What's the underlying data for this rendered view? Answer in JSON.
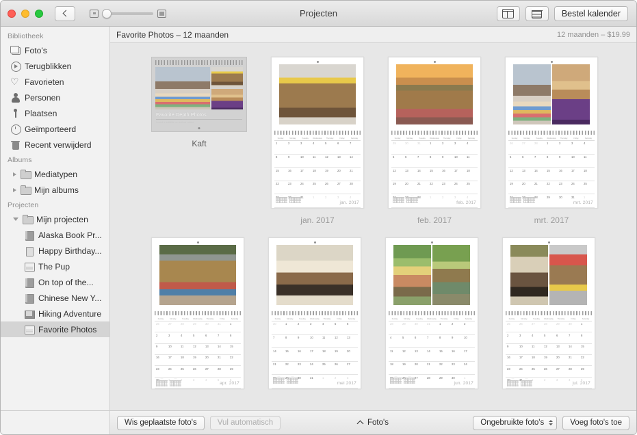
{
  "window": {
    "title": "Projecten",
    "back_button": "back-chevron",
    "order_button": "Bestel kalender",
    "layout_icon": "layout-icon",
    "info_icon": "note-icon",
    "zoom_small_icon": "zoom-out-icon",
    "zoom_large_icon": "zoom-in-icon"
  },
  "sidebar": {
    "sections": [
      {
        "header": "Bibliotheek",
        "items": [
          {
            "label": "Foto's",
            "icon": "photos-icon"
          },
          {
            "label": "Terugblikken",
            "icon": "memories-icon"
          },
          {
            "label": "Favorieten",
            "icon": "heart-icon"
          },
          {
            "label": "Personen",
            "icon": "person-icon"
          },
          {
            "label": "Plaatsen",
            "icon": "pin-icon"
          },
          {
            "label": "Geïmporteerd",
            "icon": "clock-icon"
          },
          {
            "label": "Recent verwijderd",
            "icon": "trash-icon"
          }
        ]
      },
      {
        "header": "Albums",
        "items": [
          {
            "label": "Mediatypen",
            "icon": "folder-icon",
            "disclosure": "collapsed"
          },
          {
            "label": "Mijn albums",
            "icon": "folder-icon",
            "disclosure": "collapsed"
          }
        ]
      },
      {
        "header": "Projecten",
        "items": [
          {
            "label": "Mijn projecten",
            "icon": "folder-icon",
            "disclosure": "expanded"
          }
        ],
        "children": [
          {
            "label": "Alaska Book Pr...",
            "icon": "book-icon",
            "selected": false
          },
          {
            "label": "Happy Birthday...",
            "icon": "card-icon",
            "selected": false
          },
          {
            "label": "The Pup",
            "icon": "calendar-icon",
            "selected": false
          },
          {
            "label": "On top of the...",
            "icon": "book-icon",
            "selected": false
          },
          {
            "label": "Chinese New Y...",
            "icon": "book-icon",
            "selected": false
          },
          {
            "label": "Hiking Adventure",
            "icon": "slideshow-icon",
            "selected": false
          },
          {
            "label": "Favorite Photos",
            "icon": "calendar-icon",
            "selected": true
          }
        ]
      }
    ]
  },
  "content_header": {
    "title": "Favorite Photos – 12 maanden",
    "price": "12 maanden – $19.99"
  },
  "cover": {
    "title": "Favorite Depth Photos",
    "subtitle": "Insert a subtitle or author name",
    "caption": "Kaft",
    "selected": true
  },
  "pages": [
    {
      "caption": "jan. 2017",
      "month_label": "jan. 2017",
      "photos": 1,
      "minicals": 2
    },
    {
      "caption": "feb. 2017",
      "month_label": "feb. 2017",
      "photos": 1,
      "minicals": 2
    },
    {
      "caption": "mrt. 2017",
      "month_label": "mrt. 2017",
      "photos": 2,
      "minicals": 2
    },
    {
      "caption": "",
      "month_label": "apr. 2017",
      "photos": 1,
      "minicals": 2
    },
    {
      "caption": "",
      "month_label": "mei 2017",
      "photos": 1,
      "minicals": 2
    },
    {
      "caption": "",
      "month_label": "jun. 2017",
      "photos": 2,
      "minicals": 2
    },
    {
      "caption": "",
      "month_label": "jul. 2017",
      "photos": 2,
      "minicals": 2
    }
  ],
  "calendar": {
    "day_names": [
      "Sunday",
      "Monday",
      "Tuesday",
      "Wednesday",
      "Thursday",
      "Friday",
      "Saturday"
    ],
    "grids": {
      "jan. 2017": [
        [
          "1",
          "2",
          "3",
          "4",
          "5",
          "6",
          "7"
        ],
        [
          "8",
          "9",
          "10",
          "11",
          "12",
          "13",
          "14"
        ],
        [
          "15",
          "16",
          "17",
          "18",
          "19",
          "20",
          "21"
        ],
        [
          "22",
          "23",
          "24",
          "25",
          "26",
          "27",
          "28"
        ],
        [
          "29",
          "30",
          "31",
          "1",
          "2",
          "3",
          "4"
        ]
      ],
      "feb. 2017": [
        [
          "29",
          "30",
          "31",
          "1",
          "2",
          "3",
          "4"
        ],
        [
          "5",
          "6",
          "7",
          "8",
          "9",
          "10",
          "11"
        ],
        [
          "12",
          "13",
          "14",
          "15",
          "16",
          "17",
          "18"
        ],
        [
          "19",
          "20",
          "21",
          "22",
          "23",
          "24",
          "25"
        ],
        [
          "26",
          "27",
          "28",
          "1",
          "2",
          "3",
          "4"
        ]
      ],
      "mrt. 2017": [
        [
          "26",
          "27",
          "28",
          "1",
          "2",
          "3",
          "4"
        ],
        [
          "5",
          "6",
          "7",
          "8",
          "9",
          "10",
          "11"
        ],
        [
          "12",
          "13",
          "14",
          "15",
          "16",
          "17",
          "18"
        ],
        [
          "19",
          "20",
          "21",
          "22",
          "23",
          "24",
          "25"
        ],
        [
          "26",
          "27",
          "28",
          "29",
          "30",
          "31",
          "1"
        ]
      ],
      "apr. 2017": [
        [
          "26",
          "27",
          "28",
          "29",
          "30",
          "31",
          "1"
        ],
        [
          "2",
          "3",
          "4",
          "5",
          "6",
          "7",
          "8"
        ],
        [
          "9",
          "10",
          "11",
          "12",
          "13",
          "14",
          "15"
        ],
        [
          "16",
          "17",
          "18",
          "19",
          "20",
          "21",
          "22"
        ],
        [
          "23",
          "24",
          "25",
          "26",
          "27",
          "28",
          "29"
        ],
        [
          "30",
          "1",
          "2",
          "3",
          "4",
          "5",
          "6"
        ]
      ],
      "mei 2017": [
        [
          "30",
          "1",
          "2",
          "3",
          "4",
          "5",
          "6"
        ],
        [
          "7",
          "8",
          "9",
          "10",
          "11",
          "12",
          "13"
        ],
        [
          "14",
          "15",
          "16",
          "17",
          "18",
          "19",
          "20"
        ],
        [
          "21",
          "22",
          "23",
          "24",
          "25",
          "26",
          "27"
        ],
        [
          "28",
          "29",
          "30",
          "31",
          "1",
          "2",
          "3"
        ]
      ],
      "jun. 2017": [
        [
          "28",
          "29",
          "30",
          "31",
          "1",
          "2",
          "3"
        ],
        [
          "4",
          "5",
          "6",
          "7",
          "8",
          "9",
          "10"
        ],
        [
          "11",
          "12",
          "13",
          "14",
          "15",
          "16",
          "17"
        ],
        [
          "18",
          "19",
          "20",
          "21",
          "22",
          "23",
          "24"
        ],
        [
          "25",
          "26",
          "27",
          "28",
          "29",
          "30",
          "1"
        ]
      ],
      "jul. 2017": [
        [
          "25",
          "26",
          "27",
          "28",
          "29",
          "30",
          "1"
        ],
        [
          "2",
          "3",
          "4",
          "5",
          "6",
          "7",
          "8"
        ],
        [
          "9",
          "10",
          "11",
          "12",
          "13",
          "14",
          "15"
        ],
        [
          "16",
          "17",
          "18",
          "19",
          "20",
          "21",
          "22"
        ],
        [
          "23",
          "24",
          "25",
          "26",
          "27",
          "28",
          "29"
        ],
        [
          "30",
          "31",
          "1",
          "2",
          "3",
          "4",
          "5"
        ]
      ]
    },
    "out_of_month": {
      "jan. 2017": [
        [],
        [],
        [],
        [],
        [
          3,
          4,
          5,
          6
        ]
      ],
      "feb. 2017": [
        [
          0,
          1,
          2
        ],
        [],
        [],
        [],
        [
          3,
          4,
          5,
          6
        ]
      ],
      "mrt. 2017": [
        [
          0,
          1,
          2
        ],
        [],
        [],
        [],
        [
          6
        ]
      ],
      "apr. 2017": [
        [
          0,
          1,
          2,
          3,
          4,
          5
        ],
        [],
        [],
        [],
        [],
        [
          1,
          2,
          3,
          4,
          5,
          6
        ]
      ],
      "mei 2017": [
        [
          0
        ],
        [],
        [],
        [],
        [
          4,
          5,
          6
        ]
      ],
      "jun. 2017": [
        [
          0,
          1,
          2,
          3
        ],
        [],
        [],
        [],
        [
          6
        ]
      ],
      "jul. 2017": [
        [
          0,
          1,
          2,
          3,
          4,
          5
        ],
        [],
        [],
        [],
        [],
        [
          2,
          3,
          4,
          5,
          6
        ]
      ]
    }
  },
  "bottom_bar": {
    "clear_button": "Wis geplaatste foto's",
    "autofill_button": "Vul automatisch",
    "photos_label": "Foto's",
    "filter_popup": "Ongebruikte foto's",
    "add_button": "Voeg foto's toe"
  },
  "colors": {
    "sidebar_bg": "#f2f2f2",
    "content_bg": "#e7e7e7",
    "selection": "#d4d4d4",
    "page_white": "#ffffff"
  }
}
